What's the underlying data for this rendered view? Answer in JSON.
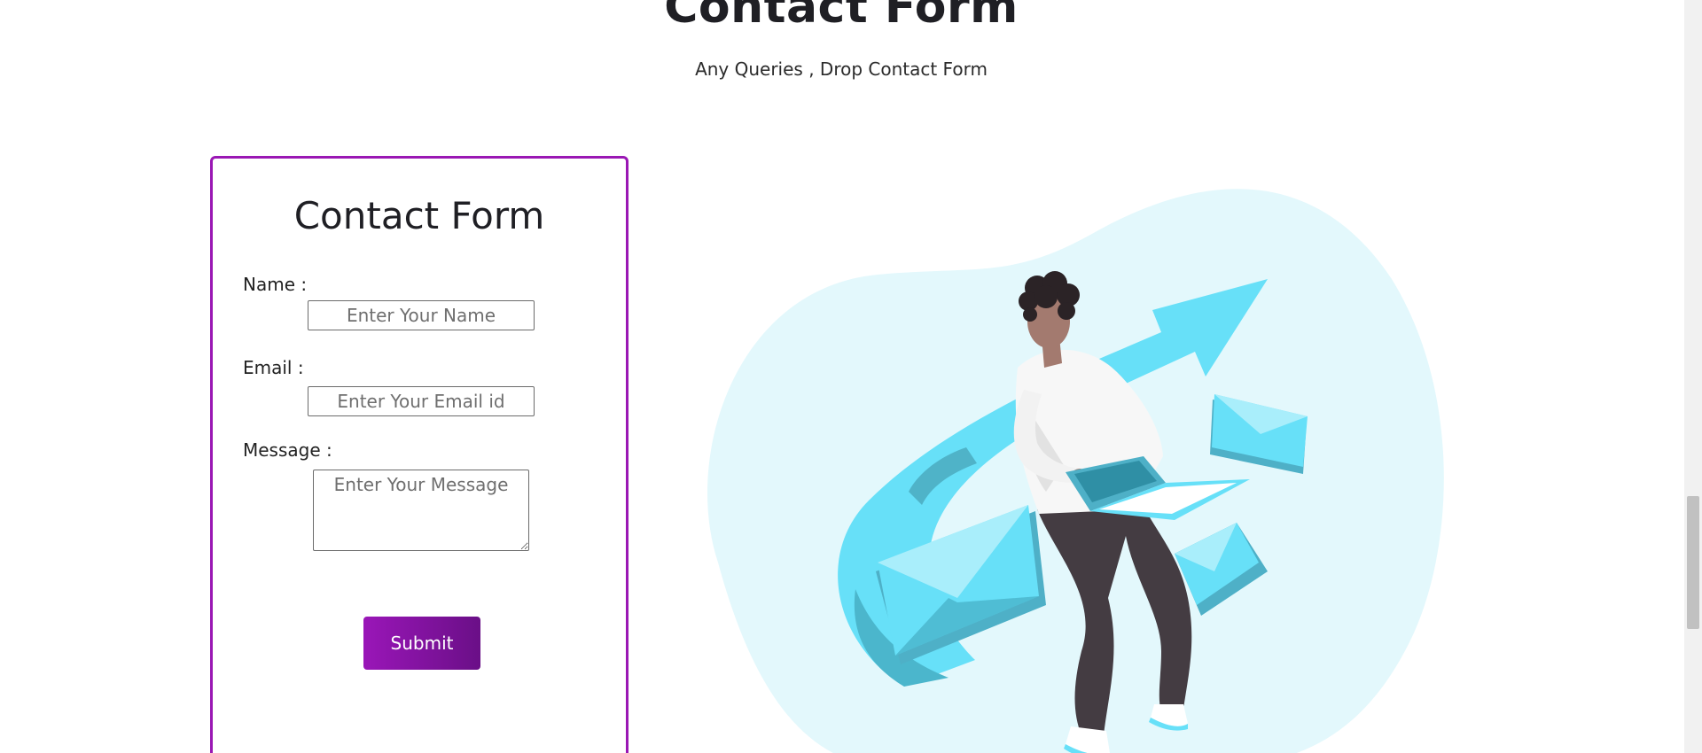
{
  "header": {
    "title": "Contact Form",
    "subtitle": "Any Queries , Drop Contact Form"
  },
  "form": {
    "title": "Contact Form",
    "name_label": "Name :",
    "name_placeholder": "Enter Your Name",
    "email_label": "Email :",
    "email_placeholder": "Enter Your Email id",
    "message_label": "Message :",
    "message_placeholder": "Enter Your Message",
    "submit_label": "Submit"
  },
  "colors": {
    "accent": "#9a17b4",
    "button_gradient_start": "#9a16b8",
    "button_gradient_end": "#6a0f87",
    "illustration_blob": "#e3f8fc",
    "illustration_blue": "#67e0f8"
  },
  "illustration": {
    "icon": "person-with-laptop-and-envelopes-illustration"
  }
}
